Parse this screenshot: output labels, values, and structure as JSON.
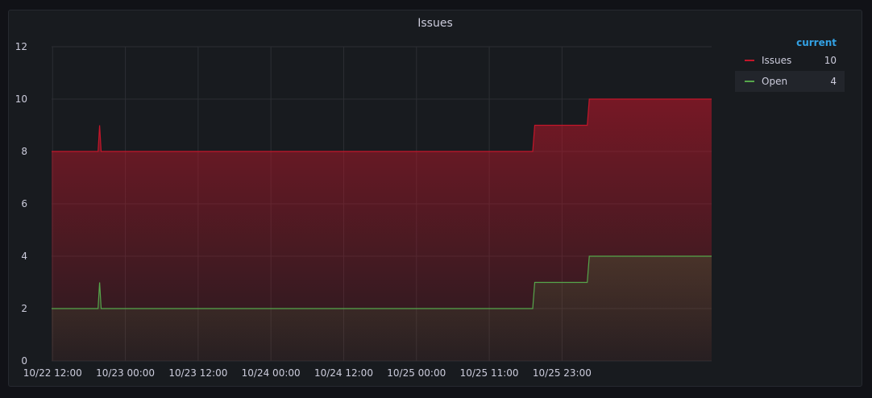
{
  "panel": {
    "title": "Issues"
  },
  "legend": {
    "header": "current",
    "items": [
      {
        "name": "Issues",
        "value": "10",
        "color": "#c4162a"
      },
      {
        "name": "Open",
        "value": "4",
        "color": "#56a64b"
      }
    ]
  },
  "chart_data": {
    "type": "area",
    "title": "Issues",
    "xlabel": "",
    "ylabel": "",
    "ylim": [
      0,
      12
    ],
    "yticks": [
      0,
      2,
      4,
      6,
      8,
      10,
      12
    ],
    "xlim": [
      "10/22 11:50",
      "10/27 00:40"
    ],
    "xticks": [
      {
        "label": "10/22 12:00",
        "t": "10/22 12:00"
      },
      {
        "label": "10/23 00:00",
        "t": "10/23 00:00"
      },
      {
        "label": "10/23 12:00",
        "t": "10/23 12:00"
      },
      {
        "label": "10/24 00:00",
        "t": "10/24 00:00"
      },
      {
        "label": "10/24 12:00",
        "t": "10/24 12:00"
      },
      {
        "label": "10/25 00:00",
        "t": "10/25 00:00"
      },
      {
        "label": "10/25 11:00",
        "t": "10/25 12:00"
      },
      {
        "label": "10/25 23:00",
        "t": "10/26 00:00"
      }
    ],
    "grid": true,
    "legend_position": "right",
    "series": [
      {
        "name": "Issues",
        "color": "#c4162a",
        "points": [
          [
            "10/22 11:50",
            8
          ],
          [
            "10/22 19:30",
            8
          ],
          [
            "10/22 19:45",
            9
          ],
          [
            "10/22 20:00",
            8
          ],
          [
            "10/25 19:10",
            8
          ],
          [
            "10/25 19:30",
            9
          ],
          [
            "10/26 04:10",
            9
          ],
          [
            "10/26 04:30",
            10
          ],
          [
            "10/27 00:40",
            10
          ]
        ]
      },
      {
        "name": "Open",
        "color": "#56a64b",
        "points": [
          [
            "10/22 11:50",
            2
          ],
          [
            "10/22 19:30",
            2
          ],
          [
            "10/22 19:45",
            3
          ],
          [
            "10/22 20:00",
            2
          ],
          [
            "10/25 19:10",
            2
          ],
          [
            "10/25 19:30",
            3
          ],
          [
            "10/26 04:10",
            3
          ],
          [
            "10/26 04:30",
            4
          ],
          [
            "10/27 00:40",
            4
          ]
        ]
      }
    ]
  }
}
